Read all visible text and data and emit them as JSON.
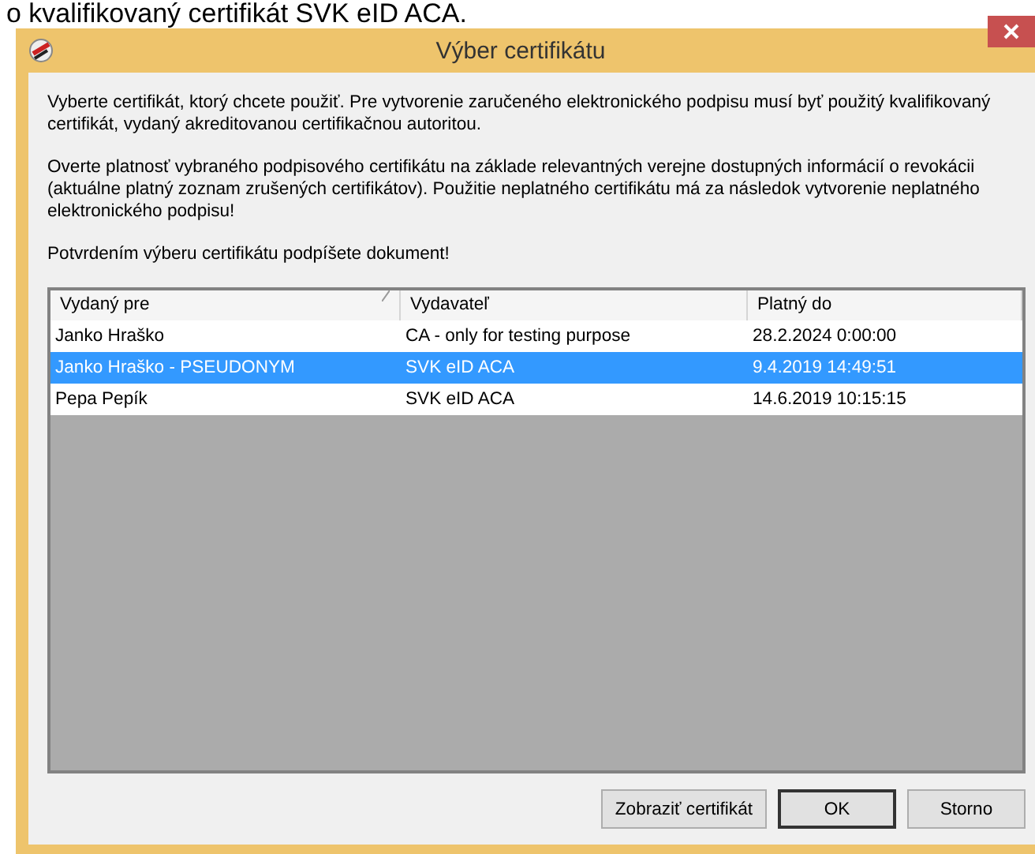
{
  "caption": "o kvalifikovaný certifikát SVK eID ACA.",
  "window": {
    "title": "Výber certifikátu"
  },
  "paragraphs": [
    "Vyberte certifikát, ktorý chcete použiť. Pre vytvorenie zaručeného elektronického podpisu musí byť použitý kvalifikovaný certifikát, vydaný akreditovanou certifikačnou autoritou.",
    "Overte platnosť vybraného podpisového certifikátu na základe relevantných verejne dostupných informácií o revokácii (aktuálne platný zoznam zrušených certifikátov). Použitie neplatného certifikátu má za následok vytvorenie neplatného elektronického podpisu!",
    "Potvrdením výberu certifikátu podpíšete dokument!"
  ],
  "table": {
    "columns": [
      "Vydaný pre",
      "Vydavateľ",
      "Platný do"
    ],
    "rows": [
      {
        "cells": [
          "Janko Hraško",
          "CA - only for testing purpose",
          "28.2.2024 0:00:00"
        ],
        "selected": false
      },
      {
        "cells": [
          "Janko Hraško - PSEUDONYM",
          "SVK eID ACA",
          "9.4.2019 14:49:51"
        ],
        "selected": true
      },
      {
        "cells": [
          "Pepa Pepík",
          "SVK eID ACA",
          "14.6.2019 10:15:15"
        ],
        "selected": false
      }
    ]
  },
  "buttons": [
    {
      "label": "Zobraziť certifikát",
      "default": false
    },
    {
      "label": "OK",
      "default": true
    },
    {
      "label": "Storno",
      "default": false
    }
  ]
}
